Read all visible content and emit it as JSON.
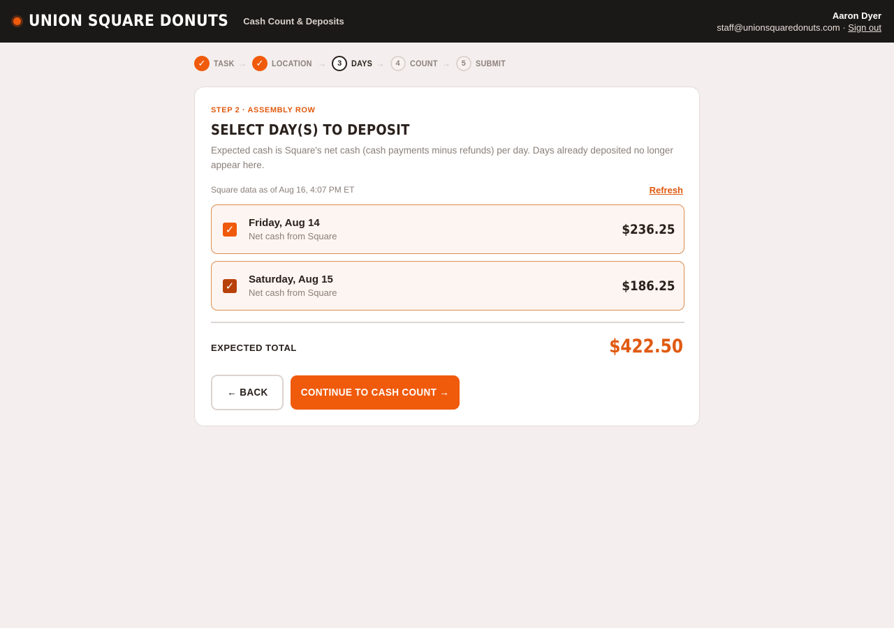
{
  "header": {
    "brand": "UNION SQUARE DONUTS",
    "subtitle": "Cash Count & Deposits",
    "user_name": "Aaron Dyer",
    "user_email": "staff@unionsquaredonuts.com",
    "separator": "·",
    "sign_out": "Sign out"
  },
  "stepper": {
    "steps": [
      {
        "marker": "✓",
        "label": "TASK",
        "state": "done"
      },
      {
        "marker": "✓",
        "label": "LOCATION",
        "state": "done"
      },
      {
        "marker": "3",
        "label": "DAYS",
        "state": "current"
      },
      {
        "marker": "4",
        "label": "COUNT",
        "state": "todo"
      },
      {
        "marker": "5",
        "label": "SUBMIT",
        "state": "todo"
      }
    ],
    "arrow": "→"
  },
  "card": {
    "eyebrow": "STEP 2 · ASSEMBLY ROW",
    "title": "SELECT DAY(S) TO DEPOSIT",
    "description": "Expected cash is Square's net cash (cash payments minus refunds) per day. Days already deposited no longer appear here.",
    "as_of": "Square data as of Aug 16, 4:07 PM ET",
    "refresh": "Refresh",
    "days": [
      {
        "name": "Friday, Aug 14",
        "sub": "Net cash from Square",
        "amount": "$236.25",
        "checked": true
      },
      {
        "name": "Saturday, Aug 15",
        "sub": "Net cash from Square",
        "amount": "$186.25",
        "checked": true
      }
    ],
    "check_mark": "✓",
    "total_label": "EXPECTED TOTAL",
    "total_amount": "$422.50",
    "back_label": "← BACK",
    "continue_label": "CONTINUE TO CASH COUNT →"
  },
  "colors": {
    "accent": "#f05a0b",
    "header_bg": "#1b1918",
    "page_bg": "#f4efee"
  }
}
